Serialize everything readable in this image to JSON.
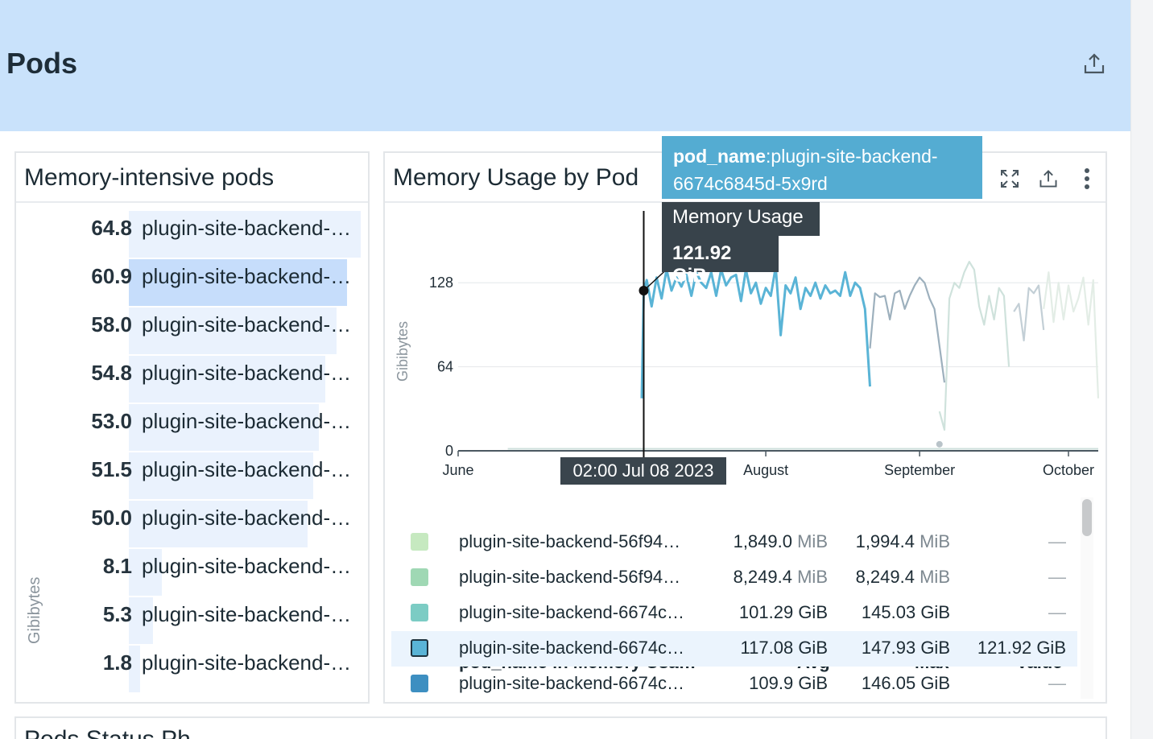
{
  "group": {
    "title": "Pods"
  },
  "toplist": {
    "title": "Memory-intensive pods",
    "y_axis_label": "Gibibytes",
    "rows": [
      {
        "value": "64.8",
        "label": "plugin-site-backend-…",
        "fraction": 1.0
      },
      {
        "value": "60.9",
        "label": "plugin-site-backend-…",
        "fraction": 0.94,
        "highlighted": true
      },
      {
        "value": "58.0",
        "label": "plugin-site-backend-…",
        "fraction": 0.895
      },
      {
        "value": "54.8",
        "label": "plugin-site-backend-…",
        "fraction": 0.846
      },
      {
        "value": "53.0",
        "label": "plugin-site-backend-…",
        "fraction": 0.818
      },
      {
        "value": "51.5",
        "label": "plugin-site-backend-…",
        "fraction": 0.795
      },
      {
        "value": "50.0",
        "label": "plugin-site-backend-…",
        "fraction": 0.772
      },
      {
        "value": "8.1",
        "label": "plugin-site-backend-…",
        "fraction": 0.143
      },
      {
        "value": "5.3",
        "label": "plugin-site-backend-…",
        "fraction": 0.105
      },
      {
        "value": "1.8",
        "label": "plugin-site-backend-…",
        "fraction": 0.05
      }
    ]
  },
  "timeseries": {
    "title": "Memory Usage by Pod",
    "icons": [
      "fullscreen-icon",
      "export-icon",
      "more-vertical-icon"
    ],
    "tooltip": {
      "tag_key": "pod_name",
      "tag_value": ":plugin-site-backend-6674c6845d-5x9rd",
      "metric": "Memory Usage",
      "value": "121.92 GiB",
      "time": "02:00 Jul 08 2023"
    },
    "legend": {
      "headers": {
        "name": "pod_name in Memory Usa…",
        "avg": "Avg",
        "max": "Max",
        "value": "Value"
      },
      "rows": [
        {
          "color": "#c6e9c0",
          "name": "plugin-site-backend-56f94…",
          "avg_num": "1,849.0",
          "avg_unit": "MiB",
          "max_num": "1,994.4",
          "max_unit": "MiB",
          "value": "—"
        },
        {
          "color": "#9fd8b4",
          "name": "plugin-site-backend-56f94…",
          "avg_num": "8,249.4",
          "avg_unit": "MiB",
          "max_num": "8,249.4",
          "max_unit": "MiB",
          "value": "—"
        },
        {
          "color": "#7cccc4",
          "name": "plugin-site-backend-6674c…",
          "avg_num": "101.29",
          "avg_unit": "GiB",
          "max_num": "145.03",
          "max_unit": "GiB",
          "value": "—"
        },
        {
          "color": "#5ab4d6",
          "name": "plugin-site-backend-6674c…",
          "avg_num": "117.08",
          "avg_unit": "GiB",
          "max_num": "147.93",
          "max_unit": "GiB",
          "value": "121.92 GiB",
          "highlighted": true
        },
        {
          "color": "#3d8fc1",
          "name": "plugin-site-backend-6674c…",
          "avg_num": "109.9",
          "avg_unit": "GiB",
          "max_num": "146.05",
          "max_unit": "GiB",
          "value": "—"
        }
      ]
    }
  },
  "next_widget": {
    "title": "Pods Status Ph"
  },
  "chart_data": {
    "type": "line",
    "title": "Memory Usage by Pod",
    "ylabel": "Gibibytes",
    "xlabel": "",
    "x_ticks": [
      "June",
      "August",
      "September",
      "October"
    ],
    "y_ticks": [
      0,
      64,
      128
    ],
    "ylim": [
      0,
      160
    ],
    "x_unit": "days since Jun 1 2023",
    "xlim": [
      0,
      129
    ],
    "grid": true,
    "series": [
      {
        "name": "plugin-site-backend-6674c…",
        "color": "#5ab4d6",
        "highlighted": true,
        "x": [
          37.0,
          37.4,
          38.0,
          39.0,
          40.0,
          41.0,
          42.0,
          43.0,
          44.0,
          45.0,
          46.0,
          47.0,
          48.0,
          49.0,
          50.0,
          51.0,
          52.0,
          53.0,
          54.0,
          55.0,
          56.0,
          57.0,
          58.0,
          59.0,
          60.0,
          61.0,
          62.0,
          63.0,
          64.0,
          65.0,
          66.0,
          67.0,
          68.0,
          69.0,
          70.0,
          71.0,
          72.0,
          73.0,
          74.0,
          75.0,
          76.0,
          77.0,
          78.0,
          79.0,
          80.0,
          81.0,
          82.0,
          83.0
        ],
        "y": [
          40,
          122,
          130,
          110,
          132,
          116,
          138,
          122,
          132,
          125,
          134,
          118,
          136,
          128,
          124,
          136,
          118,
          138,
          126,
          132,
          134,
          114,
          138,
          120,
          128,
          112,
          124,
          118,
          140,
          88,
          126,
          120,
          132,
          108,
          124,
          118,
          128,
          116,
          126,
          120,
          122,
          118,
          136,
          118,
          128,
          124,
          108,
          49
        ]
      },
      {
        "name": "plugin-site-backend-6674c…",
        "color": "#9db0bd",
        "x": [
          83.0,
          84.0,
          85.0,
          86.0,
          87.0,
          88.0,
          89.0,
          90.0,
          91.0,
          92.0,
          93.0,
          94.0,
          95.0,
          96.0,
          97.0,
          98.0
        ],
        "y": [
          78,
          120,
          117,
          118,
          100,
          120,
          122,
          108,
          118,
          126,
          132,
          128,
          116,
          108,
          80,
          52
        ]
      },
      {
        "name": "plugin-site-backend-6674c…",
        "color": "#c3cfd6",
        "x": [
          112.0,
          113.0,
          114.0,
          115.0,
          116.0,
          117.0,
          118.0
        ],
        "y": [
          106,
          112,
          84,
          124,
          120,
          126,
          92
        ]
      },
      {
        "name": "plugin-site-backend-6674c…",
        "color": "#cfe2dc",
        "x": [
          97.0,
          98.0,
          99.0,
          100.0,
          101.0,
          102.0,
          103.0,
          104.0,
          105.0,
          106.0,
          107.0,
          108.0,
          109.0,
          110.0,
          111.0
        ],
        "y": [
          30,
          16,
          116,
          128,
          124,
          136,
          144,
          138,
          110,
          96,
          118,
          100,
          124,
          118,
          64
        ]
      },
      {
        "name": "plugin-site-backend-56f94…",
        "color": "#e3ede6",
        "x": [
          118.0,
          119.0,
          120.0,
          121.0,
          122.0,
          123.0,
          124.0,
          125.0,
          126.0,
          127.0,
          128.0,
          129.0
        ],
        "y": [
          108,
          136,
          98,
          128,
          100,
          126,
          106,
          116,
          132,
          96,
          130,
          40
        ]
      }
    ]
  }
}
